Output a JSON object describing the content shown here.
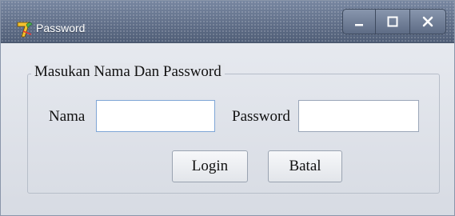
{
  "window": {
    "title": "Password",
    "icon": "delphi-app-icon",
    "controls": {
      "minimize": "minimize-icon",
      "maximize": "maximize-icon",
      "close": "close-icon"
    }
  },
  "form": {
    "group_title": "Masukan Nama Dan Password",
    "nama_label": "Nama",
    "nama_value": "",
    "password_label": "Password",
    "password_value": "",
    "login_label": "Login",
    "batal_label": "Batal"
  },
  "colors": {
    "titlebar": "#5d6c86",
    "client": "#dfe3ea",
    "input_focus_border": "#7fa6d6"
  }
}
